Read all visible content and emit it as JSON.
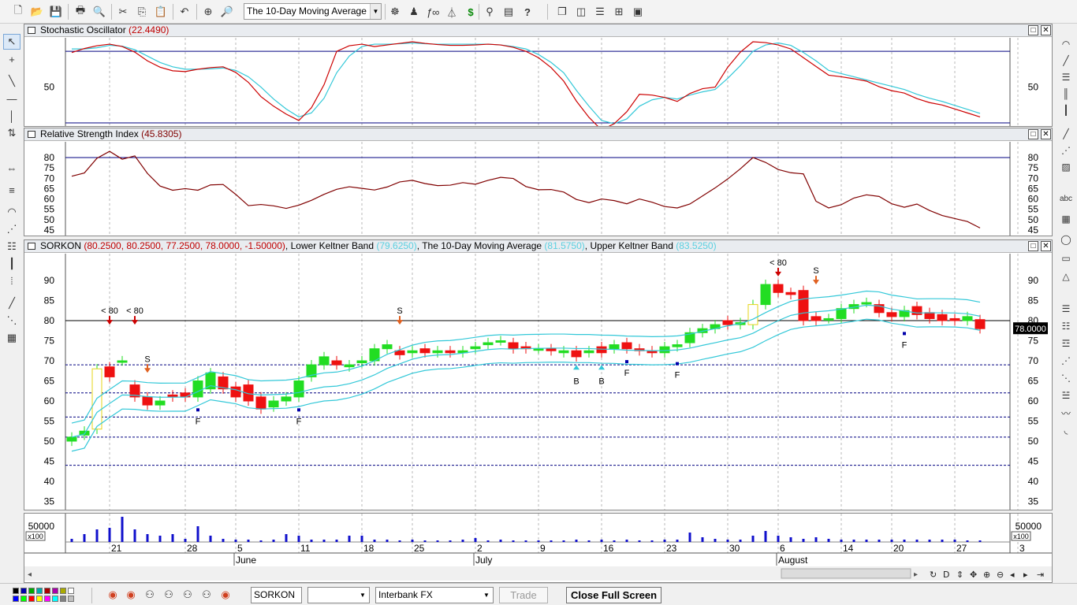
{
  "toolbar": {
    "indicator_select": "The 10-Day Moving Average",
    "dollar_label": "$",
    "help_label": "?"
  },
  "panels": {
    "stochastic": {
      "name": "Stochastic Oscillator",
      "value": "(22.4490)",
      "tick": "50"
    },
    "rsi": {
      "name": "Relative Strength Index",
      "value": "(45.8305)",
      "ticks": [
        "80",
        "75",
        "70",
        "65",
        "60",
        "55",
        "50",
        "45"
      ]
    },
    "price": {
      "symbol": "SORKON",
      "ohlc": "(80.2500, 80.2500, 77.2500, 78.0000, -1.50000)",
      "sep": ",",
      "lower_label": "Lower Keltner Band",
      "lower_value": "(79.6250)",
      "ma_label": "The 10-Day Moving Average",
      "ma_value": "(81.5750)",
      "upper_label": "Upper Keltner Band",
      "upper_value": "(83.5250)",
      "ticks": [
        "90",
        "85",
        "80",
        "75",
        "70",
        "65",
        "60",
        "55",
        "50",
        "45",
        "40",
        "35"
      ],
      "last_price": "78.0000",
      "annotations": [
        {
          "text": "< 80",
          "kind": "label"
        },
        {
          "text": "< 80",
          "kind": "label"
        },
        {
          "text": "S",
          "kind": "label"
        },
        {
          "text": "F",
          "kind": "label"
        },
        {
          "text": "F",
          "kind": "label"
        },
        {
          "text": "S",
          "kind": "label"
        },
        {
          "text": "B",
          "kind": "label"
        },
        {
          "text": "B",
          "kind": "label"
        },
        {
          "text": "F",
          "kind": "label"
        },
        {
          "text": "F",
          "kind": "label"
        },
        {
          "text": "< 80",
          "kind": "label"
        },
        {
          "text": "S",
          "kind": "label"
        },
        {
          "text": "F",
          "kind": "label"
        }
      ]
    },
    "volume": {
      "tick": "50000",
      "multiplier": "x100"
    }
  },
  "xaxis": {
    "days": [
      "21",
      "28",
      "5",
      "11",
      "18",
      "25",
      "2",
      "9",
      "16",
      "23",
      "30",
      "6",
      "14",
      "20",
      "27",
      "3"
    ],
    "months": [
      "June",
      "July",
      "August"
    ]
  },
  "window": {
    "restore_icon": "□",
    "close_icon": "✕"
  },
  "bottom": {
    "symbol_field": "SORKON",
    "second_field": "",
    "feed_field": "Interbank FX",
    "trade_button": "Trade",
    "close_fullscreen_button": "Close Full Screen"
  },
  "colors": {
    "stoch_k": "#cc0000",
    "stoch_d": "#33c8d8",
    "rsi_line": "#800000",
    "up_candle": "#22dd22",
    "down_candle": "#ee1111",
    "keltner": "#33c8d8",
    "volume": "#1010cc",
    "ref_line": "#000080"
  },
  "palette": [
    "#000000",
    "#0000aa",
    "#00aa00",
    "#00aaaa",
    "#aa0000",
    "#aa00aa",
    "#aaaa00",
    "#ffffff",
    "#0000ff",
    "#00ff00",
    "#ff0000",
    "#ffff00",
    "#ff00ff",
    "#00ffff",
    "#808080",
    "#c0c0c0"
  ]
}
